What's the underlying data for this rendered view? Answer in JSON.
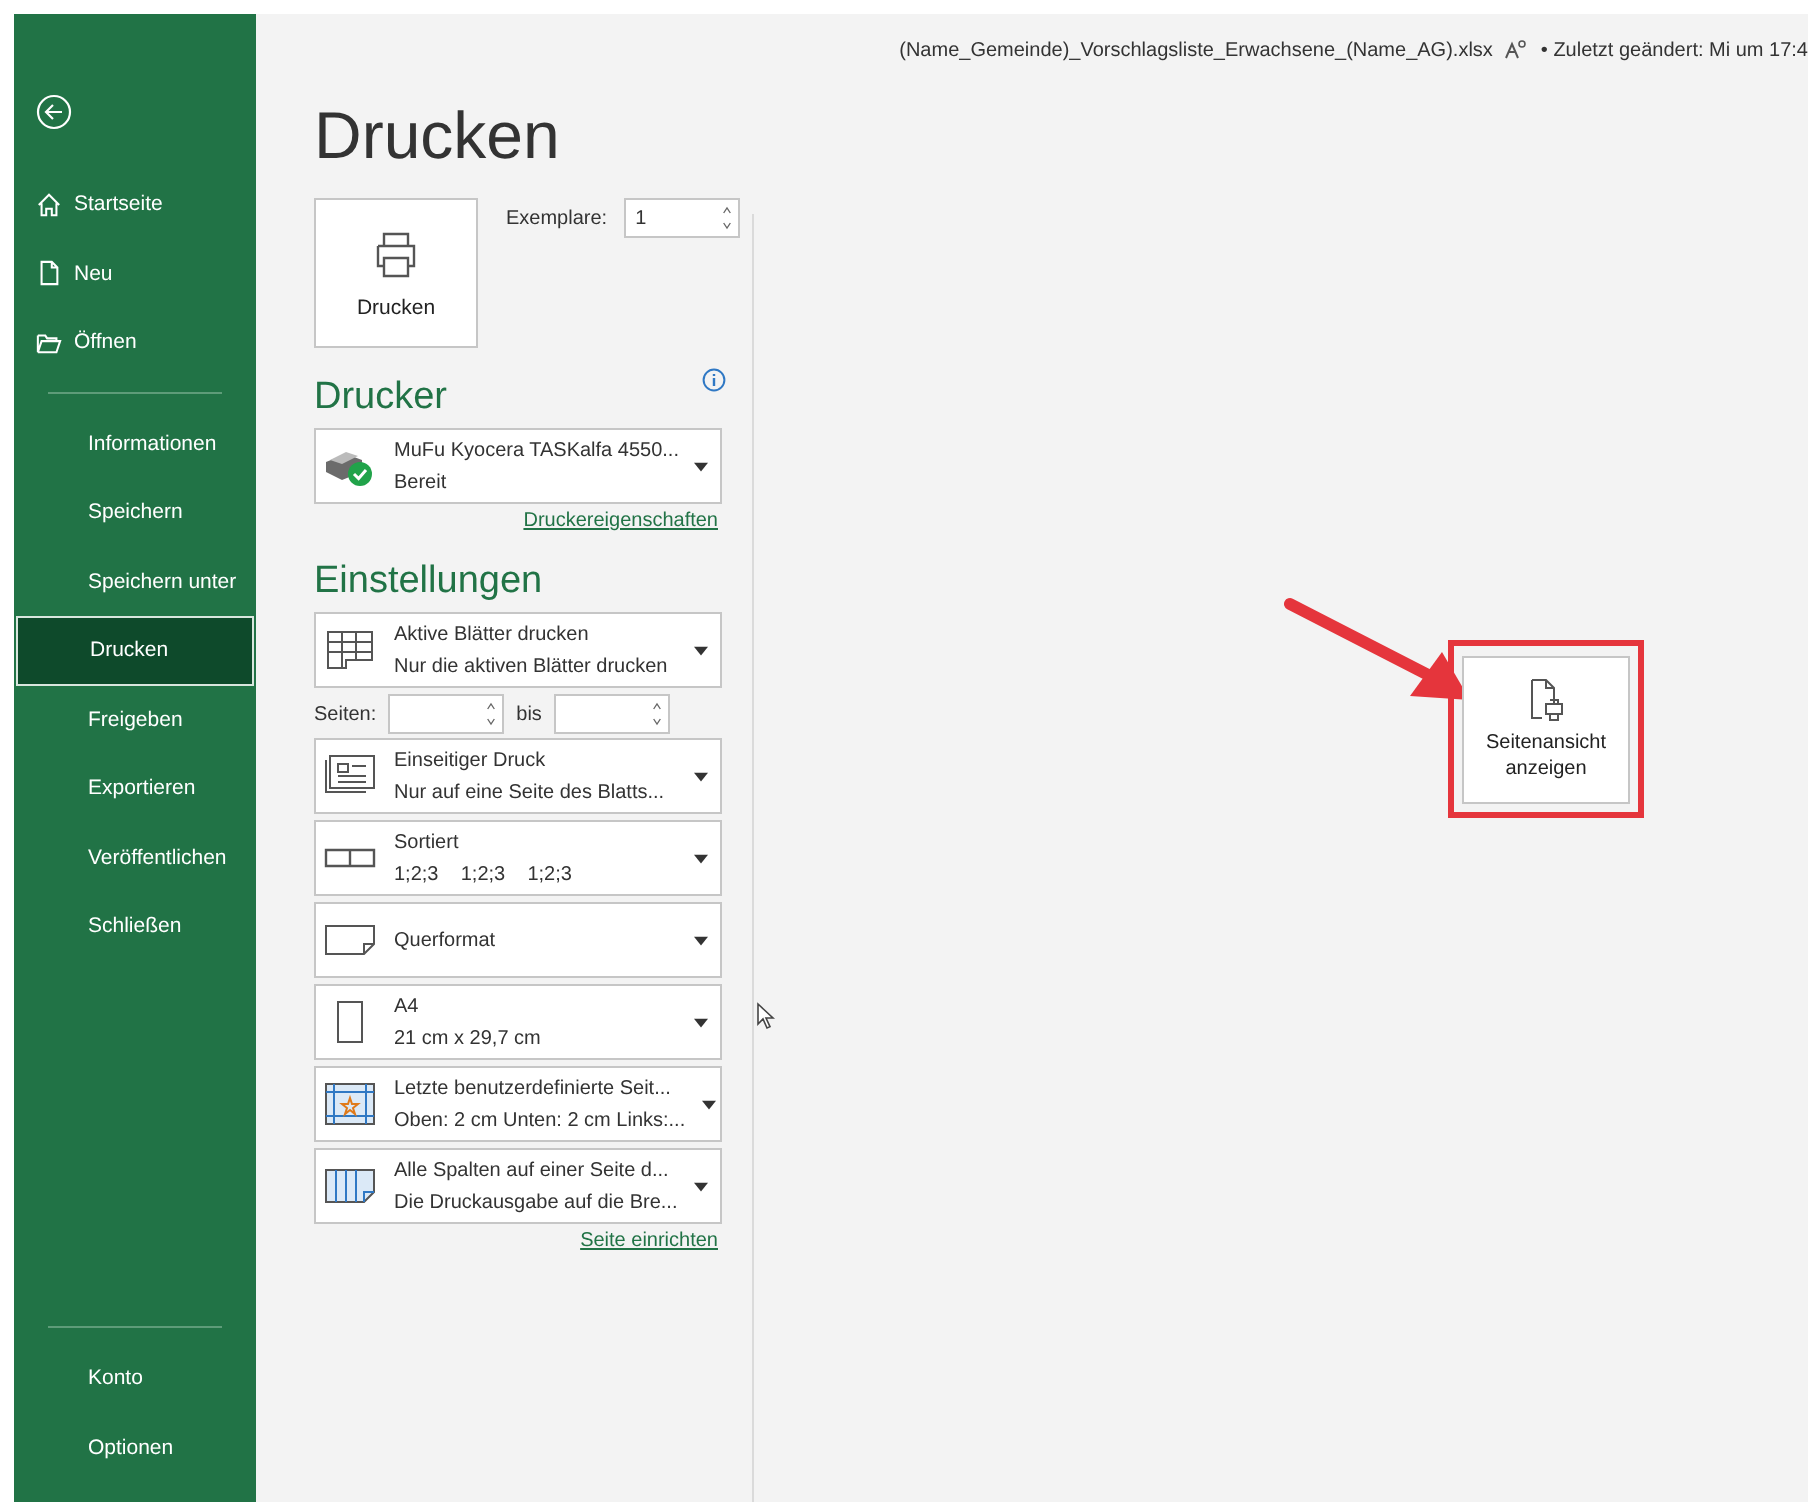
{
  "title_bar": {
    "filename": "(Name_Gemeinde)_Vorschlagsliste_Erwachsene_(Name_AG).xlsx",
    "status": "• Zuletzt geändert: Mi um 17:4"
  },
  "sidebar": {
    "top_items": [
      {
        "label": "Startseite",
        "kind": "home"
      },
      {
        "label": "Neu",
        "kind": "new"
      },
      {
        "label": "Öffnen",
        "kind": "open"
      }
    ],
    "items": [
      {
        "label": "Informationen",
        "selected": false
      },
      {
        "label": "Speichern",
        "selected": false
      },
      {
        "label": "Speichern unter",
        "selected": false
      },
      {
        "label": "Drucken",
        "selected": true
      },
      {
        "label": "Freigeben",
        "selected": false
      },
      {
        "label": "Exportieren",
        "selected": false
      },
      {
        "label": "Veröffentlichen",
        "selected": false
      },
      {
        "label": "Schließen",
        "selected": false
      }
    ],
    "bottom_items": [
      {
        "label": "Konto"
      },
      {
        "label": "Optionen"
      }
    ]
  },
  "heading": "Drucken",
  "print_button": "Drucken",
  "copies": {
    "label": "Exemplare:",
    "value": "1"
  },
  "printer": {
    "heading": "Drucker",
    "name": "MuFu Kyocera TASKalfa 4550...",
    "status": "Bereit",
    "link": "Druckereigenschaften"
  },
  "settings": {
    "heading": "Einstellungen",
    "pages": {
      "label": "Seiten:",
      "to": "bis"
    },
    "options": [
      {
        "kind": "sheets",
        "title": "Aktive Blätter drucken",
        "subtitle": "Nur die aktiven Blätter drucken"
      },
      {
        "kind": "pages",
        "title": "Einseitiger Druck",
        "subtitle": "Nur auf eine Seite des Blatts..."
      },
      {
        "kind": "collate",
        "title": "Sortiert",
        "subtitle": "1;2;3    1;2;3    1;2;3"
      },
      {
        "kind": "orientation",
        "title": "Querformat"
      },
      {
        "kind": "paper",
        "title": "A4",
        "subtitle": "21 cm x 29,7 cm"
      },
      {
        "kind": "margins",
        "title": "Letzte benutzerdefinierte Seit...",
        "subtitle": "Oben: 2 cm Unten: 2 cm Links:..."
      },
      {
        "kind": "scaling",
        "title": "Alle Spalten auf einer Seite d...",
        "subtitle": "Die Druckausgabe auf die Bre..."
      }
    ],
    "link": "Seite einrichten"
  },
  "preview_button": {
    "label": "Seitenansicht anzeigen"
  }
}
